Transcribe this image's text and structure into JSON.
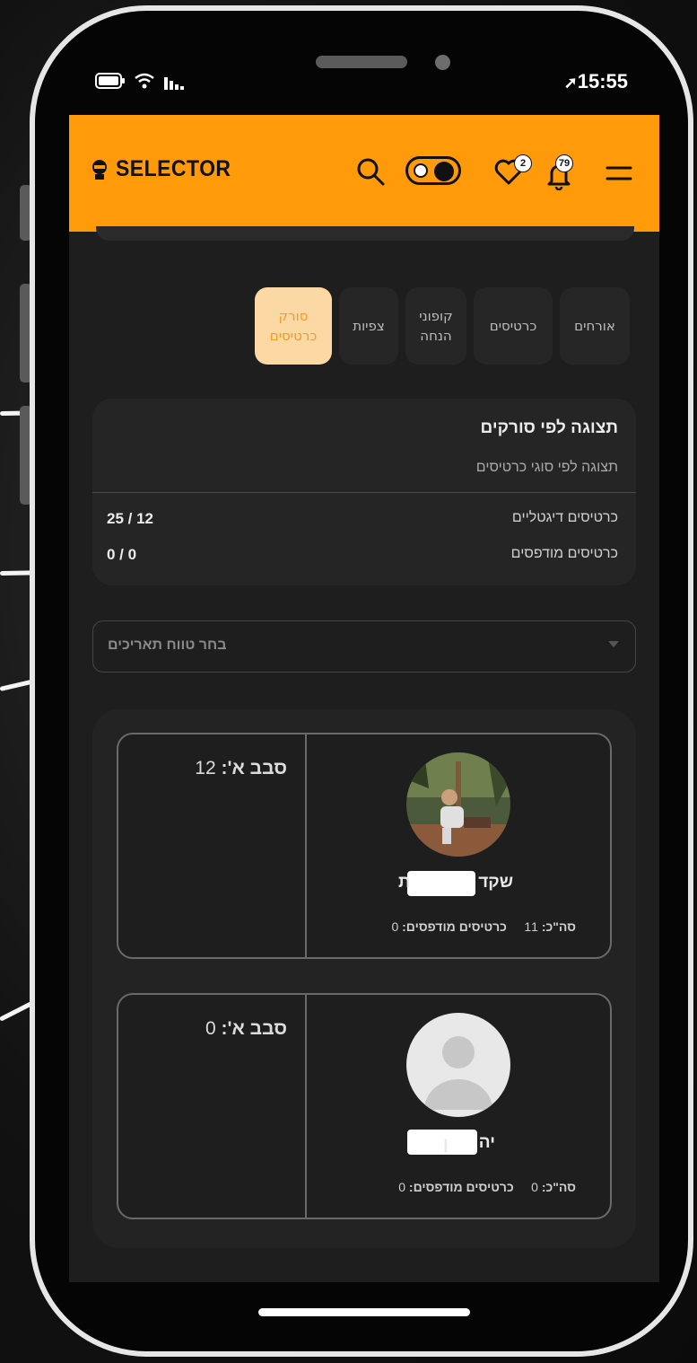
{
  "status_bar": {
    "time": "15:55"
  },
  "header": {
    "logo_text": "SELECTOR",
    "favorites_count": "2",
    "notifications_count": "79"
  },
  "tabs": [
    {
      "label": "אורחים",
      "active": false
    },
    {
      "label": "כרטיסים",
      "active": false
    },
    {
      "label": "קופוני הנחה",
      "active": false
    },
    {
      "label": "צפיות",
      "active": false
    },
    {
      "label": "סורק כרטיסים",
      "active": true
    }
  ],
  "summary": {
    "title": "תצוגה לפי סורקים",
    "subtitle": "תצוגה לפי סוגי כרטיסים",
    "rows": [
      {
        "label": "כרטיסים דיגטליים",
        "value": "25 / 12"
      },
      {
        "label": "כרטיסים מודפסים",
        "value": "0 / 0"
      }
    ]
  },
  "date_picker": {
    "placeholder": "בחר טווח תאריכים"
  },
  "sellers": [
    {
      "name_visible": "שקד",
      "name_tail": "ת",
      "total_label": "סה\"כ:",
      "total_value": "11",
      "printed_label": "כרטיסים מודפסים:",
      "printed_value": "0",
      "round_label": "סבב א':",
      "round_value": "12"
    },
    {
      "name_visible": "יה",
      "name_tail": "ן",
      "total_label": "סה\"כ:",
      "total_value": "0",
      "printed_label": "כרטיסים מודפסים:",
      "printed_value": "0",
      "round_label": "סבב א':",
      "round_value": "0"
    }
  ],
  "colors": {
    "brand": "#ff9a0a",
    "active_tab_bg": "#fcd9a4",
    "active_tab_text": "#f59a1f"
  }
}
